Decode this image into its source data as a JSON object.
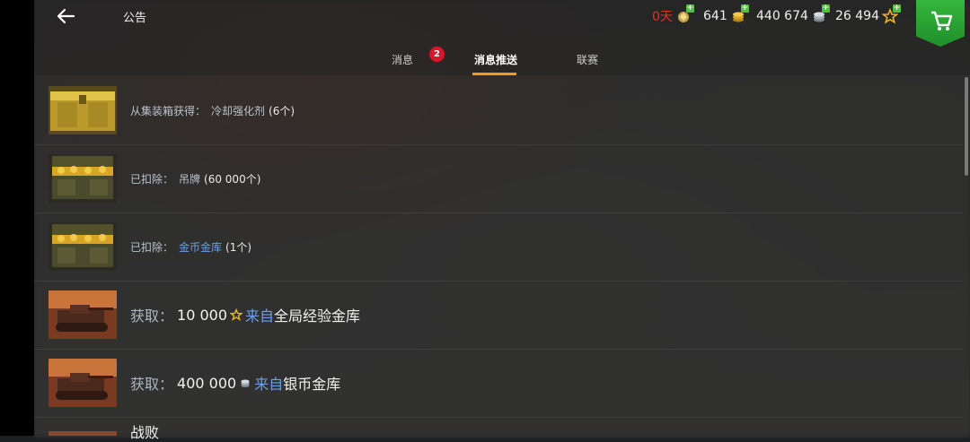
{
  "header": {
    "title": "公告",
    "resources": [
      {
        "name": "premium",
        "value": "0天"
      },
      {
        "name": "gold",
        "value": "641"
      },
      {
        "name": "silver",
        "value": "440 674"
      },
      {
        "name": "free-xp",
        "value": "26 494"
      }
    ]
  },
  "tabs": [
    {
      "label": "消息",
      "badge": "2"
    },
    {
      "label": "消息推送",
      "active": true
    },
    {
      "label": "联赛"
    }
  ],
  "notifications": [
    {
      "label": "从集装箱获得：",
      "item": "冷却强化剂",
      "qty": "(6个)"
    },
    {
      "label": "已扣除：",
      "item": "吊牌",
      "qty": "(60 000个)"
    },
    {
      "label": "已扣除：",
      "item": "金币金库",
      "qty": "(1个)"
    },
    {
      "label": "获取：",
      "amount": "10 000",
      "from": "来自",
      "source": "全局经验金库"
    },
    {
      "label": "获取：",
      "amount": "400 000",
      "from": "来自",
      "source": "银币金库"
    },
    {
      "label": "战败"
    }
  ],
  "colors": {
    "accent": "#f39a1e",
    "badge": "#d8182a",
    "link": "#6f9fe8",
    "premium": "#e3312a",
    "shop": "#2aa536"
  }
}
